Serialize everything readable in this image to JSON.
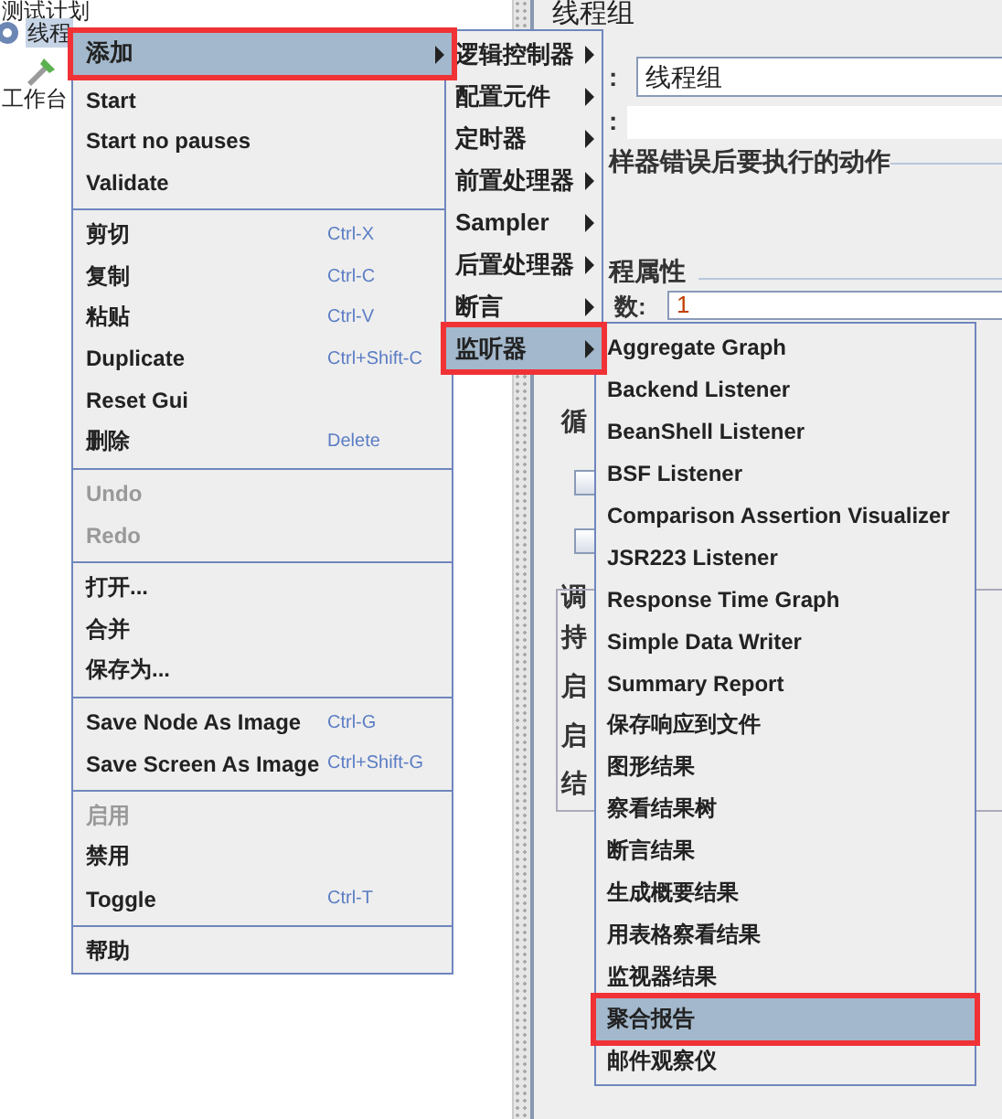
{
  "tree": {
    "items": [
      {
        "label": "测试计划",
        "selected": false
      },
      {
        "label": "线程",
        "selected": true
      },
      {
        "label": "工作台",
        "selected": false
      }
    ]
  },
  "panel": {
    "title": "线程组",
    "name_label": ":",
    "name_value": "线程组",
    "comment_label": ":",
    "error_section": "样器错误后要执行的动作",
    "props_section": "程属性",
    "threads_label": "数:",
    "threads_value": "1",
    "fragments": [
      "循",
      "调",
      "持",
      "启",
      "启",
      "结"
    ],
    "checkboxes": [
      {
        "checked": false
      },
      {
        "checked": false
      }
    ]
  },
  "context_menu": {
    "items": [
      {
        "kind": "item",
        "label": "添加",
        "submenu": true,
        "selected": true,
        "disabled": false,
        "annotated": true
      },
      {
        "kind": "item",
        "label": "Start",
        "submenu": false,
        "selected": false,
        "disabled": false,
        "annotated": false
      },
      {
        "kind": "item",
        "label": "Start no pauses",
        "submenu": false,
        "selected": false,
        "disabled": false,
        "annotated": false
      },
      {
        "kind": "item",
        "label": "Validate",
        "submenu": false,
        "selected": false,
        "disabled": false,
        "annotated": false
      },
      {
        "kind": "separator"
      },
      {
        "kind": "item",
        "label": "剪切",
        "shortcut": "Ctrl-X",
        "submenu": false,
        "selected": false,
        "disabled": false,
        "annotated": false
      },
      {
        "kind": "item",
        "label": "复制",
        "shortcut": "Ctrl-C",
        "submenu": false,
        "selected": false,
        "disabled": false,
        "annotated": false
      },
      {
        "kind": "item",
        "label": "粘贴",
        "shortcut": "Ctrl-V",
        "submenu": false,
        "selected": false,
        "disabled": false,
        "annotated": false
      },
      {
        "kind": "item",
        "label": "Duplicate",
        "shortcut": "Ctrl+Shift-C",
        "submenu": false,
        "selected": false,
        "disabled": false,
        "annotated": false
      },
      {
        "kind": "item",
        "label": "Reset Gui",
        "submenu": false,
        "selected": false,
        "disabled": false,
        "annotated": false
      },
      {
        "kind": "item",
        "label": "删除",
        "shortcut": "Delete",
        "submenu": false,
        "selected": false,
        "disabled": false,
        "annotated": false
      },
      {
        "kind": "separator"
      },
      {
        "kind": "item",
        "label": "Undo",
        "submenu": false,
        "selected": false,
        "disabled": true,
        "annotated": false
      },
      {
        "kind": "item",
        "label": "Redo",
        "submenu": false,
        "selected": false,
        "disabled": true,
        "annotated": false
      },
      {
        "kind": "separator"
      },
      {
        "kind": "item",
        "label": "打开...",
        "submenu": false,
        "selected": false,
        "disabled": false,
        "annotated": false
      },
      {
        "kind": "item",
        "label": "合并",
        "submenu": false,
        "selected": false,
        "disabled": false,
        "annotated": false
      },
      {
        "kind": "item",
        "label": "保存为...",
        "submenu": false,
        "selected": false,
        "disabled": false,
        "annotated": false
      },
      {
        "kind": "separator"
      },
      {
        "kind": "item",
        "label": "Save Node As Image",
        "shortcut": "Ctrl-G",
        "submenu": false,
        "selected": false,
        "disabled": false,
        "annotated": false
      },
      {
        "kind": "item",
        "label": "Save Screen As Image",
        "shortcut": "Ctrl+Shift-G",
        "submenu": false,
        "selected": false,
        "disabled": false,
        "annotated": false
      },
      {
        "kind": "separator"
      },
      {
        "kind": "item",
        "label": "启用",
        "submenu": false,
        "selected": false,
        "disabled": true,
        "annotated": false
      },
      {
        "kind": "item",
        "label": "禁用",
        "submenu": false,
        "selected": false,
        "disabled": false,
        "annotated": false
      },
      {
        "kind": "item",
        "label": "Toggle",
        "shortcut": "Ctrl-T",
        "submenu": false,
        "selected": false,
        "disabled": false,
        "annotated": false
      },
      {
        "kind": "separator"
      },
      {
        "kind": "item",
        "label": "帮助",
        "submenu": false,
        "selected": false,
        "disabled": false,
        "annotated": false
      }
    ]
  },
  "add_submenu": {
    "items": [
      {
        "label": "逻辑控制器",
        "submenu": true,
        "selected": false,
        "annotated": false
      },
      {
        "label": "配置元件",
        "submenu": true,
        "selected": false,
        "annotated": false
      },
      {
        "label": "定时器",
        "submenu": true,
        "selected": false,
        "annotated": false
      },
      {
        "label": "前置处理器",
        "submenu": true,
        "selected": false,
        "annotated": false
      },
      {
        "label": "Sampler",
        "submenu": true,
        "selected": false,
        "annotated": false
      },
      {
        "label": "后置处理器",
        "submenu": true,
        "selected": false,
        "annotated": false
      },
      {
        "label": "断言",
        "submenu": true,
        "selected": false,
        "annotated": false
      },
      {
        "label": "监听器",
        "submenu": true,
        "selected": true,
        "annotated": true
      }
    ]
  },
  "listener_submenu": {
    "items": [
      {
        "label": "Aggregate Graph",
        "selected": false,
        "annotated": false
      },
      {
        "label": "Backend Listener",
        "selected": false,
        "annotated": false
      },
      {
        "label": "BeanShell Listener",
        "selected": false,
        "annotated": false
      },
      {
        "label": "BSF Listener",
        "selected": false,
        "annotated": false
      },
      {
        "label": "Comparison Assertion Visualizer",
        "selected": false,
        "annotated": false
      },
      {
        "label": "JSR223 Listener",
        "selected": false,
        "annotated": false
      },
      {
        "label": "Response Time Graph",
        "selected": false,
        "annotated": false
      },
      {
        "label": "Simple Data Writer",
        "selected": false,
        "annotated": false
      },
      {
        "label": "Summary Report",
        "selected": false,
        "annotated": false
      },
      {
        "label": "保存响应到文件",
        "selected": false,
        "annotated": false
      },
      {
        "label": "图形结果",
        "selected": false,
        "annotated": false
      },
      {
        "label": "察看结果树",
        "selected": false,
        "annotated": false
      },
      {
        "label": "断言结果",
        "selected": false,
        "annotated": false
      },
      {
        "label": "生成概要结果",
        "selected": false,
        "annotated": false
      },
      {
        "label": "用表格察看结果",
        "selected": false,
        "annotated": false
      },
      {
        "label": "监视器结果",
        "selected": false,
        "annotated": false
      },
      {
        "label": "聚合报告",
        "selected": true,
        "annotated": true
      },
      {
        "label": "邮件观察仪",
        "selected": false,
        "annotated": false
      }
    ]
  }
}
